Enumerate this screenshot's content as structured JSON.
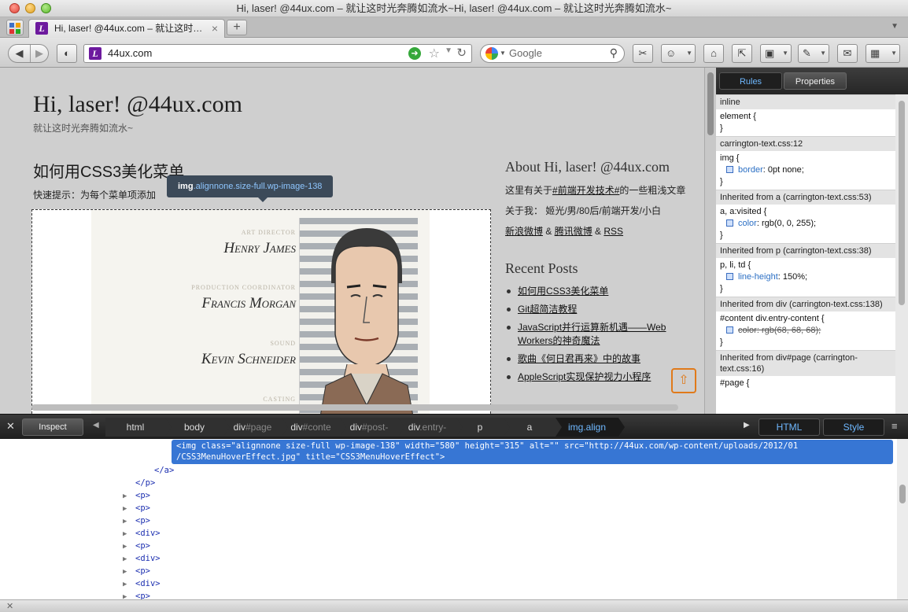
{
  "window": {
    "title": "Hi, laser! @44ux.com – 就让这时光奔腾如流水~Hi, laser! @44ux.com – 就让这时光奔腾如流水~"
  },
  "tabs": [
    {
      "label": "Hi, laser! @44ux.com – 就让这时…",
      "close": "×"
    }
  ],
  "toolbar": {
    "url": "44ux.com",
    "search_placeholder": "Google",
    "new_tab": "+"
  },
  "page": {
    "site_title": "Hi, laser! @44ux.com",
    "tagline": "就让这时光奔腾如流水~",
    "post_title": "如何用CSS3美化菜单",
    "post_intro": "快速提示：为每个菜单项添加",
    "tooltip": {
      "tag": "img",
      "classes": ".alignnone.size-full.wp-image-138"
    },
    "image_credits": [
      {
        "role": "Art Director",
        "name": "Henry James"
      },
      {
        "role": "Production Coordinator",
        "name": "Francis Morgan"
      },
      {
        "role": "Sound",
        "name": "Kevin Schneider"
      },
      {
        "role": "Casting",
        "name": ""
      }
    ],
    "sidebar": {
      "about_title": "About Hi, laser! @44ux.com",
      "about_line1_pre": "这里有关于",
      "about_line1_link": "#前端开发技术#",
      "about_line1_post": "的一些粗浅文章",
      "about_line2": "关于我：   姬光/男/80后/前端开发/小白",
      "links": [
        "新浪微博",
        "腾讯微博",
        "RSS"
      ],
      "recent_title": "Recent Posts",
      "recent_posts": [
        "如何用CSS3美化菜单",
        "Git超简洁教程",
        "JavaScript并行运算新机遇——Web Workers的神奇魔法",
        "歌曲《何日君再来》中的故事",
        "AppleScript实现保护视力小程序"
      ]
    }
  },
  "rules_panel": {
    "tabs": [
      "Rules",
      "Properties"
    ],
    "sections": [
      {
        "header": "inline",
        "selector": "element {",
        "props": [],
        "close": "}"
      },
      {
        "header": "carrington-text.css:12",
        "selector": "img {",
        "props": [
          {
            "name": "border",
            "value": "0pt none;"
          }
        ],
        "close": "}"
      },
      {
        "header": "Inherited from a (carrington-text.css:53)",
        "selector": "a, a:visited {",
        "props": [
          {
            "name": "color",
            "value": "rgb(0, 0, 255);"
          }
        ],
        "close": "}"
      },
      {
        "header": "Inherited from p (carrington-text.css:38)",
        "selector": "p, li, td {",
        "props": [
          {
            "name": "line-height",
            "value": "150%;"
          }
        ],
        "close": "}"
      },
      {
        "header": "Inherited from div (carrington-text.css:138)",
        "selector": "#content div.entry-content {",
        "props": [
          {
            "name": "color",
            "value": "rgb(68, 68, 68);"
          }
        ],
        "close": "}"
      },
      {
        "header": "Inherited from div#page (carrington-text.css:16)",
        "selector": "#page {",
        "props": [],
        "close": ""
      }
    ]
  },
  "inspector": {
    "inspect_label": "Inspect",
    "breadcrumbs": [
      {
        "tag": "html",
        "suffix": ""
      },
      {
        "tag": "body",
        "suffix": ""
      },
      {
        "tag": "div",
        "suffix": "#page"
      },
      {
        "tag": "div",
        "suffix": "#conte"
      },
      {
        "tag": "div",
        "suffix": "#post-"
      },
      {
        "tag": "div",
        "suffix": ".entry-"
      },
      {
        "tag": "p",
        "suffix": ""
      },
      {
        "tag": "a",
        "suffix": ""
      },
      {
        "tag": "img",
        "suffix": ".align"
      }
    ],
    "html_label": "HTML",
    "style_label": "Style"
  },
  "tree": {
    "selected_line1": "<img class=\"alignnone size-full wp-image-138\" width=\"580\" height=\"315\" alt=\"\" src=\"http://44ux.com/wp-content/uploads/2012/01",
    "selected_line2": "/CSS3MenuHoverEffect.jpg\" title=\"CSS3MenuHoverEffect\">",
    "close_a": "</a>",
    "close_p": "</p>",
    "nodes": [
      "<p>",
      "<p>",
      "<p>",
      "<div>",
      "<p>",
      "<div>",
      "<p>",
      "<div>",
      "<p>"
    ]
  }
}
